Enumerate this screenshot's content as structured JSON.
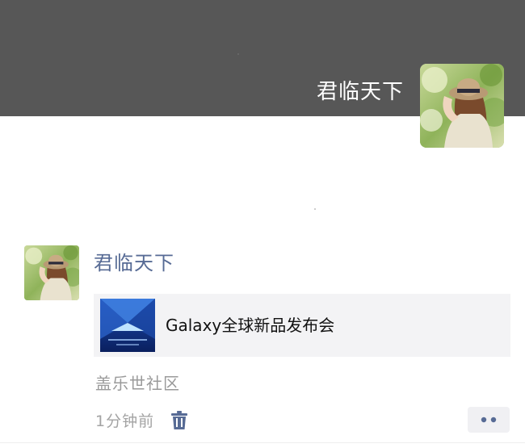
{
  "profile": {
    "name": "君临天下",
    "cover_color": "#575757",
    "avatar_icon": "avatar-girl-with-hat"
  },
  "post": {
    "author": "君临天下",
    "author_color": "#576b95",
    "link": {
      "title": "Galaxy全球新品发布会",
      "thumbnail_icon": "galaxy-unpacked-thumbnail"
    },
    "source": "盖乐世社区",
    "time": "1分钟前",
    "delete_icon": "trash-icon",
    "more_icon": "more-dots-icon"
  }
}
